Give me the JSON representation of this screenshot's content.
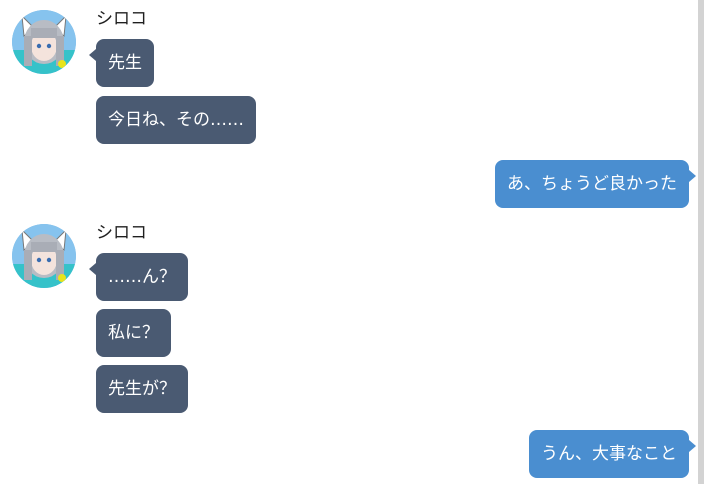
{
  "chat": {
    "groups": [
      {
        "speaker": "シロコ",
        "avatar_icon": "shiroko-avatar-icon",
        "messages": [
          "先生",
          "今日ね、その……"
        ]
      },
      {
        "speaker": "シロコ",
        "avatar_icon": "shiroko-avatar-icon",
        "messages": [
          "……ん？",
          "私に？",
          "先生が？"
        ]
      }
    ],
    "replies": [
      "あ、ちょうど良かった",
      "うん、大事なこと"
    ]
  },
  "colors": {
    "npc_bubble": "#4a5a72",
    "player_bubble": "#4a8ed0",
    "scrollbar": "#d3d3d3"
  }
}
